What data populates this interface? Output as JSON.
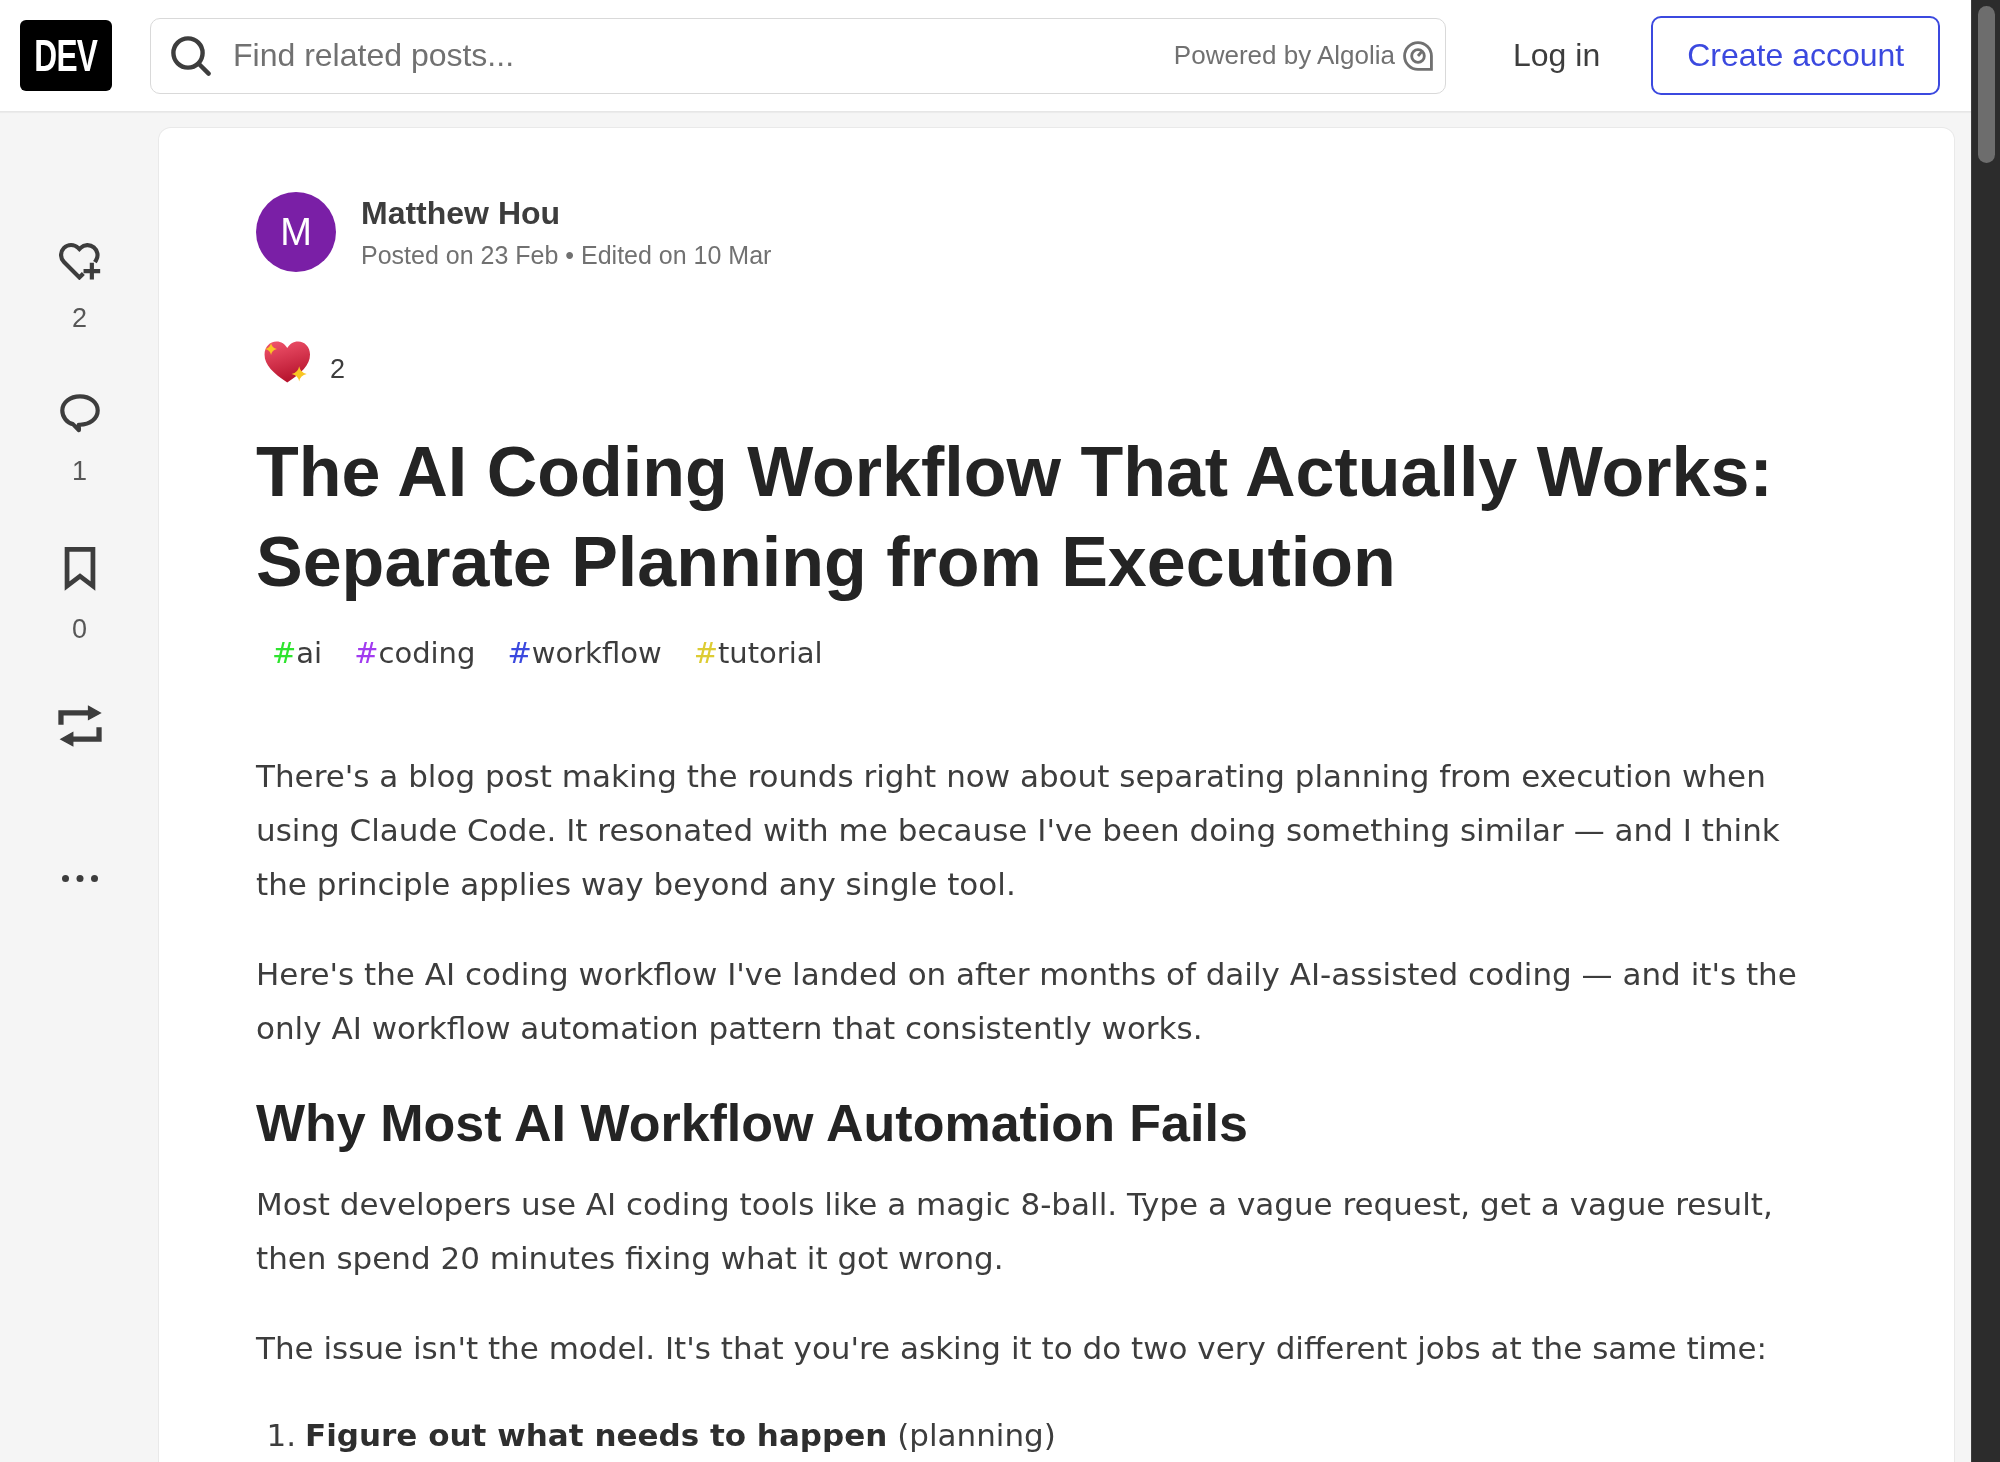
{
  "header": {
    "logo": "DEV",
    "search": {
      "placeholder": "Find related posts...",
      "powered_by": "Powered by Algolia"
    },
    "buttons": [
      {
        "kind": "login",
        "label": "Log in"
      },
      {
        "kind": "signup",
        "label": "Create account"
      }
    ]
  },
  "sidebar": {
    "actions": [
      {
        "kind": "like",
        "count": "2"
      },
      {
        "kind": "comment",
        "count": "1"
      },
      {
        "kind": "bookmark",
        "count": "0"
      },
      {
        "kind": "repost"
      },
      {
        "kind": "more"
      }
    ]
  },
  "article": {
    "author": {
      "initial": "M",
      "name": "Matthew Hou",
      "meta": "Posted on 23 Feb • Edited on 10 Mar"
    },
    "reaction": {
      "count": "2"
    },
    "title": "The AI Coding Workflow That Actually Works: Separate Planning from Execution",
    "tags": [
      {
        "hash": "#",
        "name": "ai",
        "color": "#2ee42e"
      },
      {
        "hash": "#",
        "name": "coding",
        "color": "#a23bf0"
      },
      {
        "hash": "#",
        "name": "workflow",
        "color": "#3b49df"
      },
      {
        "hash": "#",
        "name": "tutorial",
        "color": "#ddcc33"
      }
    ],
    "body": [
      {
        "kind": "paragraph",
        "text": "There's a blog post making the rounds right now about separating planning from execution when using Claude Code. It resonated with me because I've been doing something similar — and I think the principle applies way beyond any single tool."
      },
      {
        "kind": "paragraph",
        "text": "Here's the AI coding workflow I've landed on after months of daily AI-assisted coding — and it's the only AI workflow automation pattern that consistently works."
      },
      {
        "kind": "heading",
        "text": "Why Most AI Workflow Automation Fails"
      },
      {
        "kind": "paragraph",
        "text": "Most developers use AI coding tools like a magic 8-ball. Type a vague request, get a vague result, then spend 20 minutes fixing what it got wrong."
      },
      {
        "kind": "paragraph",
        "text": "The issue isn't the model. It's that you're asking it to do two very different jobs at the same time:"
      },
      {
        "kind": "list",
        "items": [
          {
            "number": "1.",
            "text": "**Figure out what needs to happen** (planning)"
          }
        ]
      }
    ]
  }
}
